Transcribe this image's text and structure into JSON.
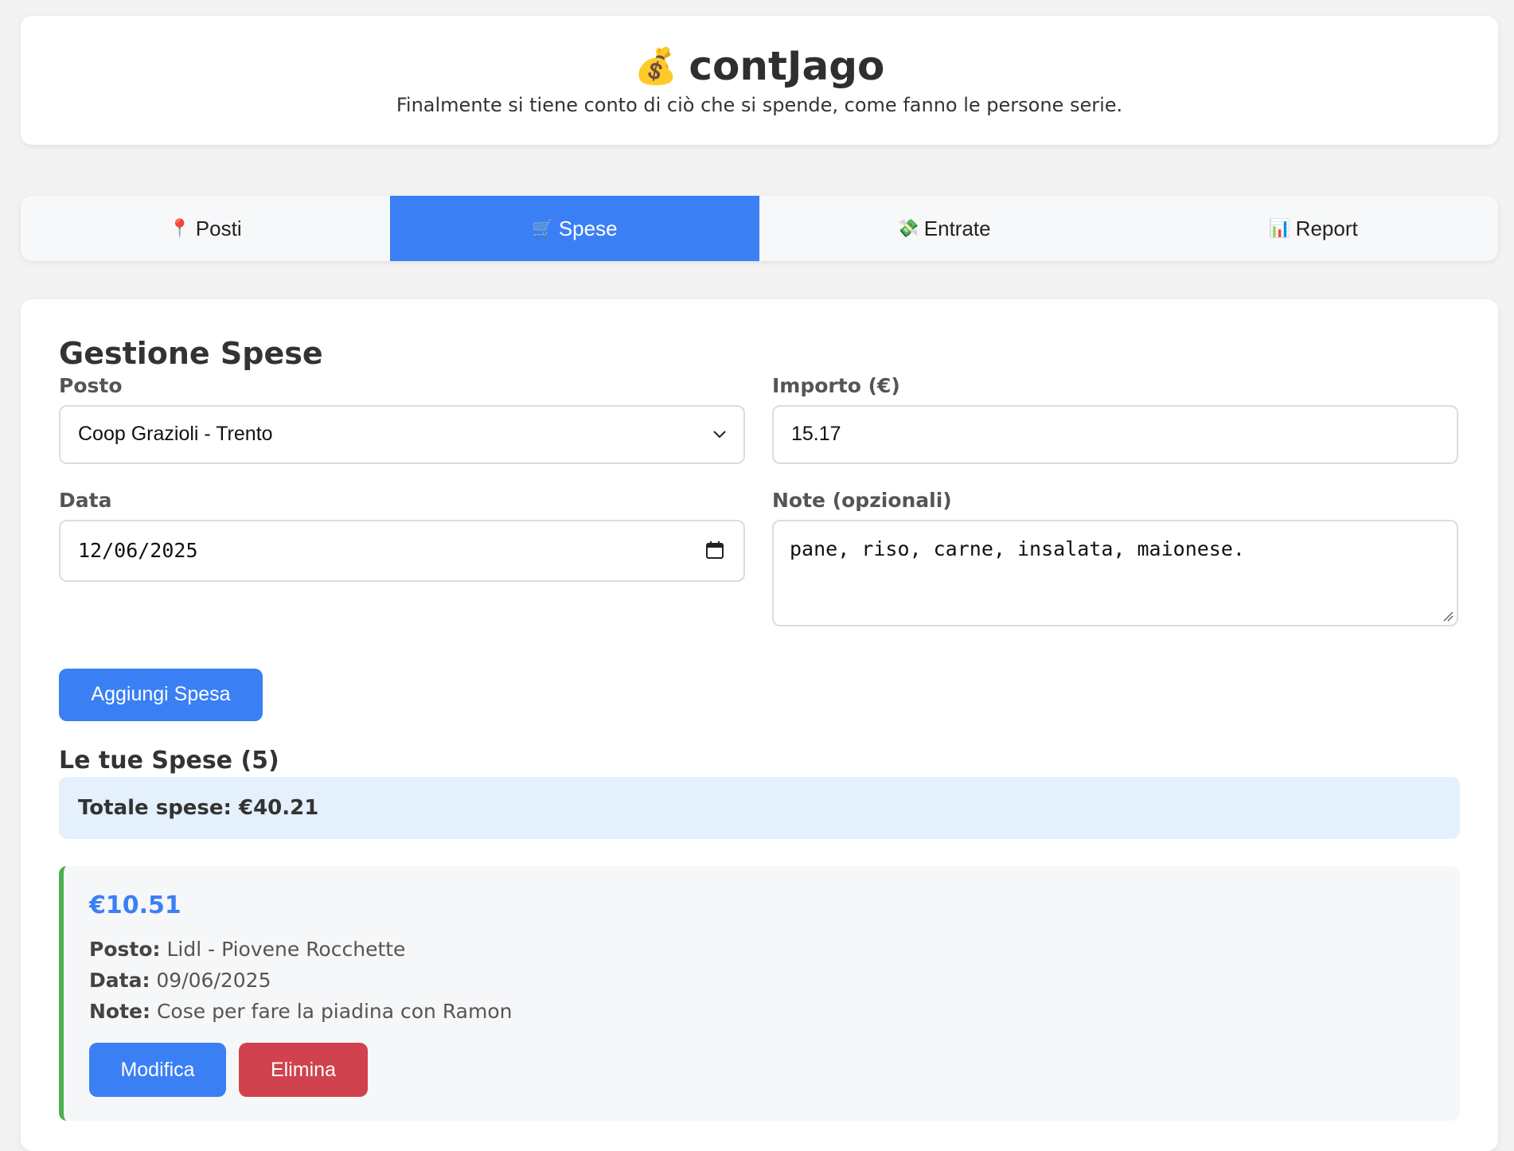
{
  "app": {
    "icon": "money-bag-icon",
    "emoji": "💰",
    "title": "contJago",
    "subtitle": "Finalmente si tiene conto di ciò che si spende, come fanno le persone serie."
  },
  "tabs": [
    {
      "label": "Posti",
      "emoji": "📍",
      "icon": "pin-icon",
      "active": false
    },
    {
      "label": "Spese",
      "emoji": "🛒",
      "icon": "cart-icon",
      "active": true
    },
    {
      "label": "Entrate",
      "emoji": "💸",
      "icon": "money-wings-icon",
      "active": false
    },
    {
      "label": "Report",
      "emoji": "📊",
      "icon": "bar-chart-icon",
      "active": false
    }
  ],
  "form": {
    "heading": "Gestione Spese",
    "posto_label": "Posto",
    "posto_value": "Coop Grazioli - Trento",
    "importo_label": "Importo (€)",
    "importo_value": "15.17",
    "data_label": "Data",
    "data_value": "12/06/2025",
    "note_label": "Note (opzionali)",
    "note_value": "pane, riso, carne, insalata, maionese.",
    "submit_label": "Aggiungi Spesa"
  },
  "list": {
    "title": "Le tue Spese (5)",
    "total": "Totale spese: €40.21",
    "items": [
      {
        "amount": "€10.51",
        "posto_label": "Posto:",
        "posto": "Lidl - Piovene Rocchette",
        "data_label": "Data:",
        "data": "09/06/2025",
        "note_label": "Note:",
        "note": "Cose per fare la piadina con Ramon",
        "edit_label": "Modifica",
        "delete_label": "Elimina"
      }
    ]
  },
  "colors": {
    "accent": "#3b7ff5",
    "danger": "#d0424d",
    "success_border": "#4caf50",
    "total_bg": "#e4f0fb"
  }
}
